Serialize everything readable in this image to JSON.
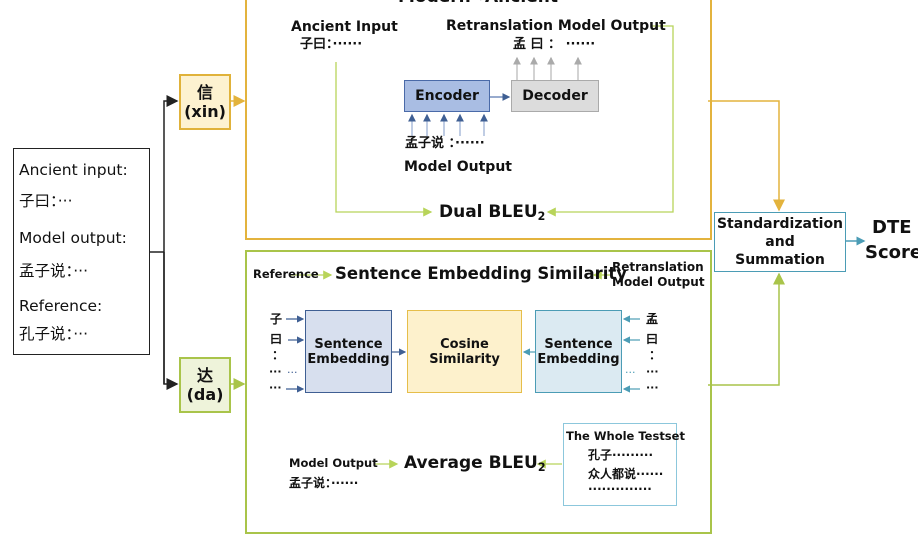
{
  "input_panel": {
    "ancient_input_label": "Ancient input:",
    "ancient_input_value": "子曰：···",
    "model_output_label": "Model output:",
    "model_output_value": "孟子说：···",
    "reference_label": "Reference:",
    "reference_value": "孔子说：···"
  },
  "branches": {
    "xin": {
      "char": "信",
      "pinyin": "(xin)"
    },
    "da": {
      "char": "达",
      "pinyin": "(da)"
    }
  },
  "xin_section": {
    "title": "Modern→Ancient",
    "ancient_input_label": "Ancient Input",
    "ancient_input_value": "子曰：······",
    "retranslation_label": "Retranslation Model Output",
    "retranslation_value": "孟 曰 ：  ······",
    "encoder_label": "Encoder",
    "decoder_label": "Decoder",
    "model_output_value": "孟子说 ：······",
    "model_output_label": "Model Output",
    "metric": "Dual BLEU",
    "metric_subscript": "2"
  },
  "da_section": {
    "reference_label": "Reference",
    "similarity_title": "Sentence Embedding Similarity",
    "retranslation_label_line1": "Retranslation",
    "retranslation_label_line2": "Model Output",
    "left_tokens": [
      "子",
      "曰",
      "：",
      "···  ···",
      "···"
    ],
    "right_tokens": [
      "孟",
      "曰",
      "：",
      "···  ···",
      "···"
    ],
    "sentence_embedding_left": [
      "Sentence",
      "Embedding"
    ],
    "cosine_similarity": [
      "Cosine",
      "Similarity"
    ],
    "sentence_embedding_right": [
      "Sentence",
      "Embedding"
    ],
    "model_output_label": "Model Output",
    "model_output_value": "孟子说：······",
    "metric": "Average BLEU",
    "metric_subscript": "2",
    "testset": {
      "title": "The  Whole Testset",
      "lines": [
        "孔子·········",
        "众人都说······",
        "··············"
      ]
    }
  },
  "aggregation": {
    "lines": [
      "Standardization",
      "and",
      "Summation"
    ],
    "result_line1": "DTE",
    "result_line2": "Score"
  },
  "colors": {
    "xin": "#e3b33d",
    "da": "#a9c44a",
    "encoder": "#a9bde3",
    "teal": "#4b9cb5",
    "navy": "#3f5f93"
  }
}
